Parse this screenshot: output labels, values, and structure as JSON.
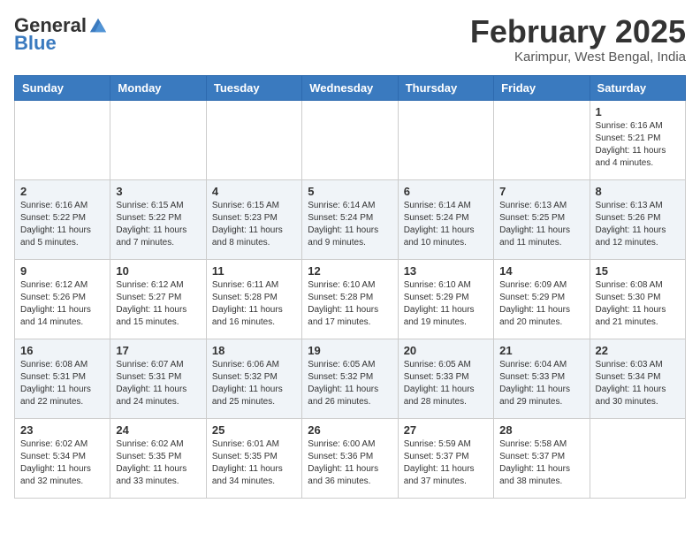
{
  "header": {
    "logo_general": "General",
    "logo_blue": "Blue",
    "month_title": "February 2025",
    "location": "Karimpur, West Bengal, India"
  },
  "days_of_week": [
    "Sunday",
    "Monday",
    "Tuesday",
    "Wednesday",
    "Thursday",
    "Friday",
    "Saturday"
  ],
  "weeks": [
    [
      {
        "day": "",
        "info": ""
      },
      {
        "day": "",
        "info": ""
      },
      {
        "day": "",
        "info": ""
      },
      {
        "day": "",
        "info": ""
      },
      {
        "day": "",
        "info": ""
      },
      {
        "day": "",
        "info": ""
      },
      {
        "day": "1",
        "info": "Sunrise: 6:16 AM\nSunset: 5:21 PM\nDaylight: 11 hours\nand 4 minutes."
      }
    ],
    [
      {
        "day": "2",
        "info": "Sunrise: 6:16 AM\nSunset: 5:22 PM\nDaylight: 11 hours\nand 5 minutes."
      },
      {
        "day": "3",
        "info": "Sunrise: 6:15 AM\nSunset: 5:22 PM\nDaylight: 11 hours\nand 7 minutes."
      },
      {
        "day": "4",
        "info": "Sunrise: 6:15 AM\nSunset: 5:23 PM\nDaylight: 11 hours\nand 8 minutes."
      },
      {
        "day": "5",
        "info": "Sunrise: 6:14 AM\nSunset: 5:24 PM\nDaylight: 11 hours\nand 9 minutes."
      },
      {
        "day": "6",
        "info": "Sunrise: 6:14 AM\nSunset: 5:24 PM\nDaylight: 11 hours\nand 10 minutes."
      },
      {
        "day": "7",
        "info": "Sunrise: 6:13 AM\nSunset: 5:25 PM\nDaylight: 11 hours\nand 11 minutes."
      },
      {
        "day": "8",
        "info": "Sunrise: 6:13 AM\nSunset: 5:26 PM\nDaylight: 11 hours\nand 12 minutes."
      }
    ],
    [
      {
        "day": "9",
        "info": "Sunrise: 6:12 AM\nSunset: 5:26 PM\nDaylight: 11 hours\nand 14 minutes."
      },
      {
        "day": "10",
        "info": "Sunrise: 6:12 AM\nSunset: 5:27 PM\nDaylight: 11 hours\nand 15 minutes."
      },
      {
        "day": "11",
        "info": "Sunrise: 6:11 AM\nSunset: 5:28 PM\nDaylight: 11 hours\nand 16 minutes."
      },
      {
        "day": "12",
        "info": "Sunrise: 6:10 AM\nSunset: 5:28 PM\nDaylight: 11 hours\nand 17 minutes."
      },
      {
        "day": "13",
        "info": "Sunrise: 6:10 AM\nSunset: 5:29 PM\nDaylight: 11 hours\nand 19 minutes."
      },
      {
        "day": "14",
        "info": "Sunrise: 6:09 AM\nSunset: 5:29 PM\nDaylight: 11 hours\nand 20 minutes."
      },
      {
        "day": "15",
        "info": "Sunrise: 6:08 AM\nSunset: 5:30 PM\nDaylight: 11 hours\nand 21 minutes."
      }
    ],
    [
      {
        "day": "16",
        "info": "Sunrise: 6:08 AM\nSunset: 5:31 PM\nDaylight: 11 hours\nand 22 minutes."
      },
      {
        "day": "17",
        "info": "Sunrise: 6:07 AM\nSunset: 5:31 PM\nDaylight: 11 hours\nand 24 minutes."
      },
      {
        "day": "18",
        "info": "Sunrise: 6:06 AM\nSunset: 5:32 PM\nDaylight: 11 hours\nand 25 minutes."
      },
      {
        "day": "19",
        "info": "Sunrise: 6:05 AM\nSunset: 5:32 PM\nDaylight: 11 hours\nand 26 minutes."
      },
      {
        "day": "20",
        "info": "Sunrise: 6:05 AM\nSunset: 5:33 PM\nDaylight: 11 hours\nand 28 minutes."
      },
      {
        "day": "21",
        "info": "Sunrise: 6:04 AM\nSunset: 5:33 PM\nDaylight: 11 hours\nand 29 minutes."
      },
      {
        "day": "22",
        "info": "Sunrise: 6:03 AM\nSunset: 5:34 PM\nDaylight: 11 hours\nand 30 minutes."
      }
    ],
    [
      {
        "day": "23",
        "info": "Sunrise: 6:02 AM\nSunset: 5:34 PM\nDaylight: 11 hours\nand 32 minutes."
      },
      {
        "day": "24",
        "info": "Sunrise: 6:02 AM\nSunset: 5:35 PM\nDaylight: 11 hours\nand 33 minutes."
      },
      {
        "day": "25",
        "info": "Sunrise: 6:01 AM\nSunset: 5:35 PM\nDaylight: 11 hours\nand 34 minutes."
      },
      {
        "day": "26",
        "info": "Sunrise: 6:00 AM\nSunset: 5:36 PM\nDaylight: 11 hours\nand 36 minutes."
      },
      {
        "day": "27",
        "info": "Sunrise: 5:59 AM\nSunset: 5:37 PM\nDaylight: 11 hours\nand 37 minutes."
      },
      {
        "day": "28",
        "info": "Sunrise: 5:58 AM\nSunset: 5:37 PM\nDaylight: 11 hours\nand 38 minutes."
      },
      {
        "day": "",
        "info": ""
      }
    ]
  ]
}
